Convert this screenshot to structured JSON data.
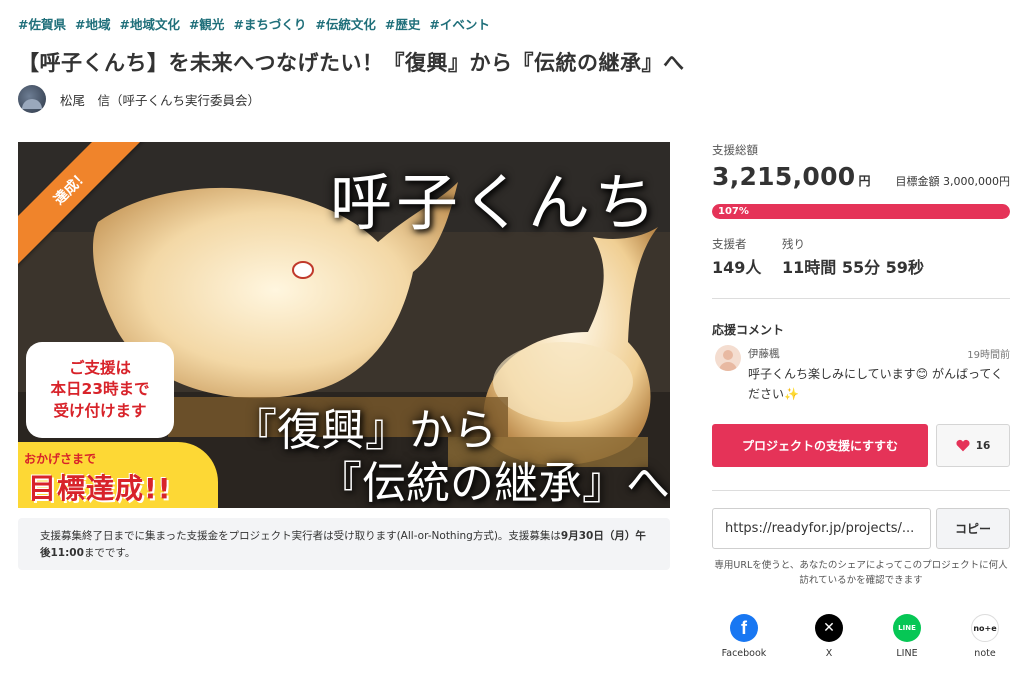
{
  "tags": [
    "#佐賀県",
    "#地域",
    "#地域文化",
    "#観光",
    "#まちづくり",
    "#伝統文化",
    "#歴史",
    "#イベント"
  ],
  "title": "【呼子くんち】を未来へつなげたい！『復興』から『伝統の継承』へ",
  "owner": {
    "name": "松尾　信（呼子くんち実行委員会）",
    "avatar_icon": "owner-avatar"
  },
  "hero": {
    "main_title": "呼子くんち",
    "subtitle_line1": "『復興』から",
    "subtitle_line2": "『伝統の継承』へ",
    "ribbon": "達成！",
    "deadline_lines": [
      "ご支援は",
      "本日23時まで",
      "受け付けます"
    ],
    "thanks": "おかげさまで",
    "goal_reached": "目標達成!!"
  },
  "notice": {
    "text1": "支援募集終了日までに集まった支援金をプロジェクト実行者は受け取ります(All-or-Nothing方式)。支援募集は",
    "bold": "9月30日（月）午後11:00",
    "text2": "までです。"
  },
  "sidebar": {
    "total_label": "支援総額",
    "total_amount": "3,215,000",
    "currency": "円",
    "goal_label": "目標金額 3,000,000円",
    "progress_percent": 107,
    "progress_label": "107%",
    "supporters_label": "支援者",
    "supporters_value": "149人",
    "remaining_label": "残り",
    "remaining_value": "11時間 55分 59秒",
    "comments_heading": "応援コメント",
    "comment": {
      "user": "伊藤楓",
      "time": "19時間前",
      "text": "呼子くんち楽しみにしています😊 がんばってください✨"
    },
    "support_button": "プロジェクトの支援にすすむ",
    "like_count": "16",
    "url_value": "https://readyfor.jp/projects/...",
    "copy_button": "コピー",
    "url_note": "専用URLを使うと、あなたのシェアによってこのプロジェクトに何人訪れているかを確認できます",
    "shares": [
      {
        "label": "Facebook",
        "icon": "facebook-icon",
        "glyph": "f"
      },
      {
        "label": "X",
        "icon": "x-icon",
        "glyph": "✕"
      },
      {
        "label": "LINE",
        "icon": "line-icon",
        "glyph": "LINE"
      },
      {
        "label": "note",
        "icon": "note-icon",
        "glyph": "no+e"
      }
    ]
  },
  "colors": {
    "accent": "#e53358",
    "tag": "#1f6f7a",
    "ribbon": "#f0842b",
    "highlight": "#fdd835"
  }
}
